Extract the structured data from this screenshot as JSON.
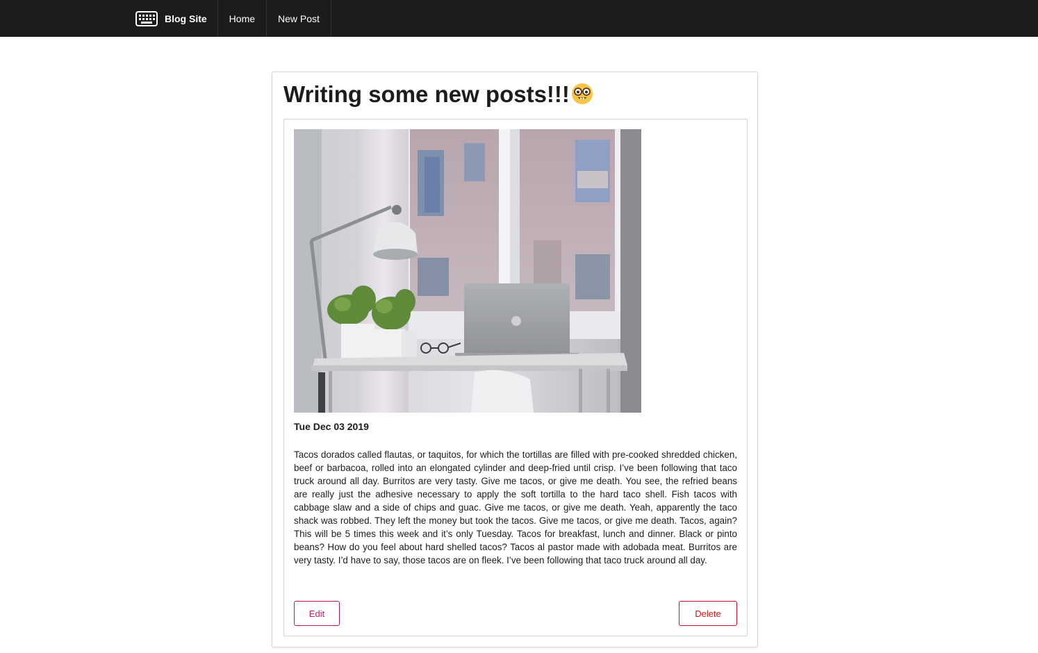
{
  "navbar": {
    "brand_label": "Blog Site",
    "brand_icon": "keyboard-icon",
    "items": [
      {
        "label": "Home"
      },
      {
        "label": "New Post"
      }
    ]
  },
  "post": {
    "title": "Writing some new posts!!!",
    "title_emoji": "nerd-face-emoji",
    "image_description_icon": "desk-photo",
    "date": "Tue Dec 03 2019",
    "body": "Tacos dorados called flautas, or taquitos, for which the tortillas are filled with pre-cooked shredded chicken, beef or barbacoa, rolled into an elongated cylinder and deep-fried until crisp. I’ve been following that taco truck around all day. Burritos are very tasty. Give me tacos, or give me death. You see, the refried beans are really just the adhesive necessary to apply the soft tortilla to the hard taco shell. Fish tacos with cabbage slaw and a side of chips and guac. Give me tacos, or give me death. Yeah, apparently the taco shack was robbed. They left the money but took the tacos. Give me tacos, or give me death. Tacos, again? This will be 5 times this week and it’s only Tuesday. Tacos for breakfast, lunch and dinner. Black or pinto beans? How do you feel about hard shelled tacos? Tacos al pastor made with adobada meat. Burritos are very tasty. I’d have to say, those tacos are on fleek. I’ve been following that taco truck around all day.",
    "edit_label": "Edit",
    "delete_label": "Delete"
  },
  "colors": {
    "navbar_bg": "#1b1c1d",
    "edit_accent": "#c41d6f",
    "delete_accent": "#d01919"
  }
}
